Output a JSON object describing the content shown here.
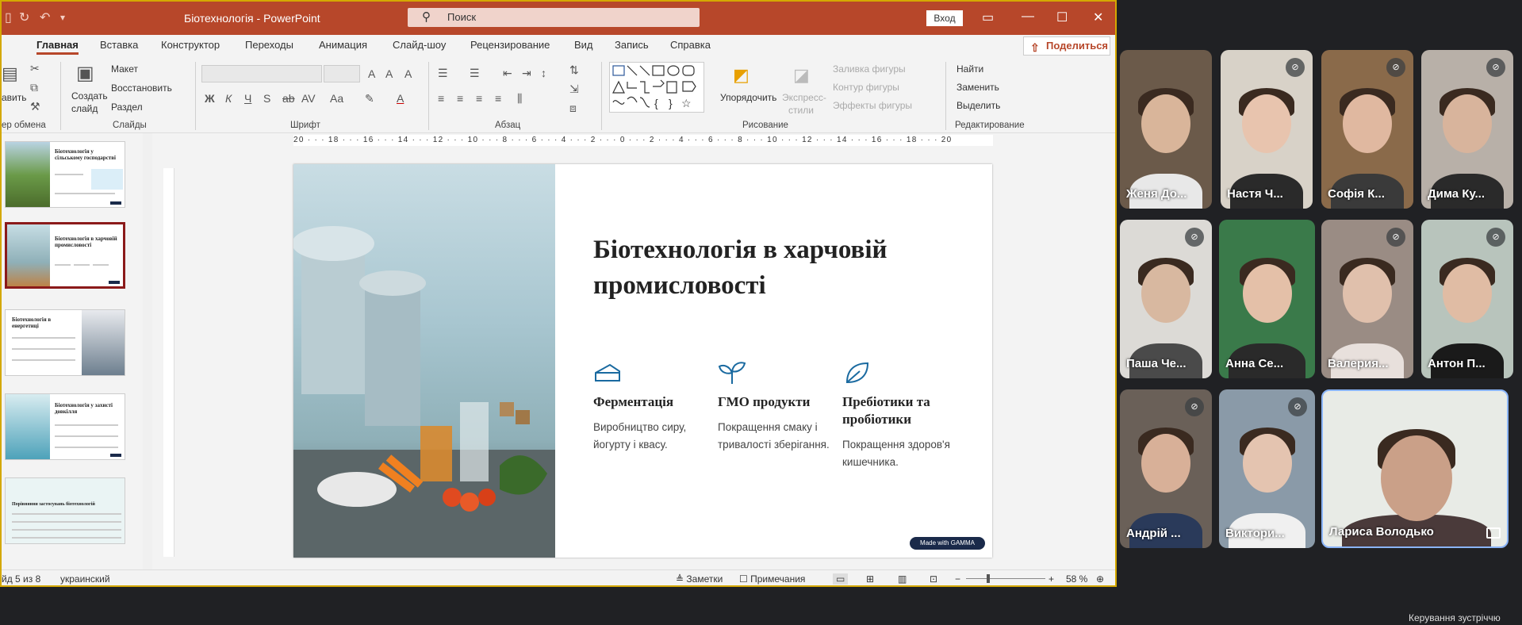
{
  "window": {
    "title": "Біотехнологія  -  PowerPoint",
    "search_placeholder": "Поиск",
    "signin": "Вход"
  },
  "ribbon_tabs": [
    "Главная",
    "Вставка",
    "Конструктор",
    "Переходы",
    "Анимация",
    "Слайд-шоу",
    "Рецензирование",
    "Вид",
    "Запись",
    "Справка"
  ],
  "share_label": "Поделиться",
  "ribbon": {
    "paste_partial": "авить",
    "create_slide_1": "Создать",
    "create_slide_2": "слайд",
    "layout": "Макет",
    "restore": "Восстановить",
    "section": "Раздел",
    "arrange_1": "Упорядочить",
    "quick_styles_1": "Экспресс-",
    "quick_styles_2": "стили",
    "fill": "Заливка фигуры",
    "outline": "Контур фигуры",
    "effects": "Эффекты фигуры",
    "find": "Найти",
    "replace": "Заменить",
    "select": "Выделить",
    "groups": {
      "clipboard": "ер обмена",
      "slides": "Слайды",
      "font": "Шрифт",
      "paragraph": "Абзац",
      "drawing": "Рисование",
      "editing": "Редактирование"
    }
  },
  "thumbnails": [
    {
      "title": "Біотехнологія у сільському господарстві",
      "selected": false
    },
    {
      "title": "Біотехнологія в харчовій промисловості",
      "selected": true
    },
    {
      "title": "Біотехнологія в енергетиці",
      "selected": false
    },
    {
      "title": "Біотехнологія у захисті довкілля",
      "selected": false
    },
    {
      "title": "Порівняння застосувань біотехнологій",
      "selected": false
    }
  ],
  "ruler": "20 · · · 18 · · · 16 · · · 14 · · · 12 · · · 10 · · · 8 · · · 6 · · · 4 · · · 2 · · · 0 · · · 2 · · · 4 · · · 6 · · · 8 · · · 10 · · · 12 · · · 14 · · · 16 · · · 18 · · · 20",
  "slide": {
    "title": "Біотехнологія в харчовій промисловості",
    "features": [
      {
        "icon": "cheese-icon",
        "heading": "Ферментація",
        "text": "Виробництво сиру, йогурту і квасу."
      },
      {
        "icon": "sprout-icon",
        "heading": "ГМО продукти",
        "text": "Покращення смаку і тривалості зберігання."
      },
      {
        "icon": "leaf-icon",
        "heading": "Пребіотики та пробіотики",
        "text": "Покращення здоров'я кишечника."
      }
    ],
    "made_with": "Made with GAMMA"
  },
  "status": {
    "slide_info": "йд 5 из 8",
    "language": "украинский",
    "notes": "Заметки",
    "comments": "Примечания",
    "zoom": "58 %"
  },
  "participants": [
    {
      "name": "Женя До...",
      "muted": false,
      "bg": "#6b5a4a",
      "face": "#d9b59a",
      "shirt": "#e8e8e8"
    },
    {
      "name": "Настя Ч...",
      "muted": true,
      "bg": "#d8d2c8",
      "face": "#e8c4ae",
      "shirt": "#2a2a2a"
    },
    {
      "name": "Софія К...",
      "muted": true,
      "bg": "#8a6a4a",
      "face": "#e0b8a0",
      "shirt": "#3a3a3a"
    },
    {
      "name": "Дима Ку...",
      "muted": true,
      "bg": "#b8b0a8",
      "face": "#d8b49c",
      "shirt": "#2a2a2a"
    },
    {
      "name": "Паша Че...",
      "muted": true,
      "bg": "#dcdad6",
      "face": "#d8b8a0",
      "shirt": "#4a4a4a"
    },
    {
      "name": "Анна Се...",
      "muted": false,
      "bg": "#3a7a4a",
      "face": "#e4c0a8",
      "shirt": "#2a2a2a"
    },
    {
      "name": "Валерия...",
      "muted": true,
      "bg": "#9a8c84",
      "face": "#e0c0ac",
      "shirt": "#e8e0dc"
    },
    {
      "name": "Антон П...",
      "muted": true,
      "bg": "#b8c4bc",
      "face": "#e0bca4",
      "shirt": "#1a1a1a"
    },
    {
      "name": "Андрій ...",
      "muted": true,
      "bg": "#6a6058",
      "face": "#d8b098",
      "shirt": "#2a3a5a"
    },
    {
      "name": "Виктори...",
      "muted": true,
      "bg": "#8a9aa8",
      "face": "#e4c4b0",
      "shirt": "#f0f0f0"
    },
    {
      "name": "Лариса Володько",
      "muted": false,
      "bg": "#e8ebe6",
      "face": "#caa088",
      "shirt": "#4a3a3a"
    }
  ],
  "meeting_controls": "Керування зустріччю"
}
